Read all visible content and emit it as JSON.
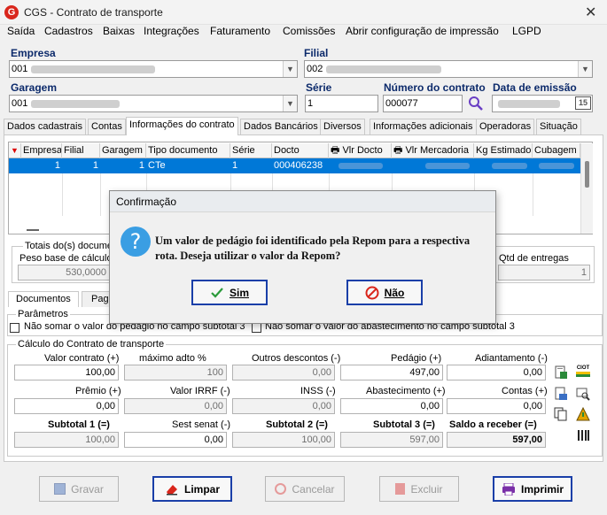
{
  "window": {
    "title": "CGS - Contrato de transporte",
    "close": "✕"
  },
  "menu": [
    "Saída",
    "Cadastros",
    "Baixas",
    "Integrações",
    "Faturamento",
    "Comissões",
    "Abrir configuração de impressão",
    "LGPD"
  ],
  "header": {
    "empresa_label": "Empresa",
    "empresa_value": "001",
    "filial_label": "Filial",
    "filial_value": "002",
    "garagem_label": "Garagem",
    "garagem_value": "001",
    "serie_label": "Série",
    "serie_value": "1",
    "numero_label": "Número do contrato",
    "numero_value": "000077",
    "data_label": "Data de emissão",
    "calendar_text": "15"
  },
  "tabs": [
    "Dados cadastrais",
    "Contas",
    "Informações do contrato",
    "Dados Bancários",
    "Diversos",
    "Informações adicionais",
    "Operadoras",
    "Situação"
  ],
  "grid": {
    "headers": [
      "Empresa",
      "Filial",
      "Garagem",
      "Tipo documento",
      "Série",
      "Docto",
      "Vlr Docto",
      "Vlr Mercadoria",
      "Kg Estimado",
      "Cubagem"
    ],
    "row": [
      "1",
      "1",
      "1",
      "CTe",
      "1",
      "000406238",
      "",
      "",
      "",
      ""
    ]
  },
  "totals": {
    "title": "Totais do(s) documen",
    "peso_label": "Peso base de cálculo",
    "peso_value": "530,0000",
    "qtd_label": "Qtd de entregas",
    "qtd_value": "1"
  },
  "subtabs": [
    "Documentos",
    "Paga"
  ],
  "parametros": {
    "title": "Parâmetros",
    "opt1": "Não somar o valor do pedágio no campo subtotal 3",
    "opt2": "Não somar o valor do abastecimento no campo subtotal 3"
  },
  "calculo": {
    "title": "Cálculo do Contrato de transporte",
    "valor_contrato": {
      "label": "Valor contrato (+)",
      "value": "100,00"
    },
    "maximo_adto": {
      "label": "máximo adto %",
      "value": "100"
    },
    "outros_descontos": {
      "label": "Outros descontos (-)",
      "value": "0,00"
    },
    "pedagio": {
      "label": "Pedágio (+)",
      "value": "497,00"
    },
    "adiantamento": {
      "label": "Adiantamento (-)",
      "value": "0,00"
    },
    "premio": {
      "label": "Prêmio (+)",
      "value": "0,00"
    },
    "valor_irrf": {
      "label": "Valor IRRF (-)",
      "value": "0,00"
    },
    "inss": {
      "label": "INSS (-)",
      "value": "0,00"
    },
    "abastecimento": {
      "label": "Abastecimento (+)",
      "value": "0,00"
    },
    "contas": {
      "label": "Contas (+)",
      "value": "0,00"
    },
    "subtotal1": {
      "label": "Subtotal 1 (=)",
      "value": "100,00"
    },
    "sest_senat": {
      "label": "Sest senat (-)",
      "value": "0,00"
    },
    "subtotal2": {
      "label": "Subtotal 2 (=)",
      "value": "100,00"
    },
    "subtotal3": {
      "label": "Subtotal 3 (=)",
      "value": "597,00"
    },
    "saldo": {
      "label": "Saldo a receber (=)",
      "value": "597,00"
    },
    "ciot_label": "CIOT"
  },
  "footer": {
    "gravar": "Gravar",
    "limpar": "Limpar",
    "cancelar": "Cancelar",
    "excluir": "Excluir",
    "imprimir": "Imprimir"
  },
  "dialog": {
    "title": "Confirmação",
    "message": "Um valor de pedágio foi identificado pela Repom para a respectiva rota. Deseja utilizar o valor da Repom?",
    "yes": "Sim",
    "no": "Não"
  },
  "colors": {
    "accent": "#0078d7",
    "button_border": "#1a3fa8",
    "label": "#0c2a6b",
    "danger": "#d9261c"
  }
}
